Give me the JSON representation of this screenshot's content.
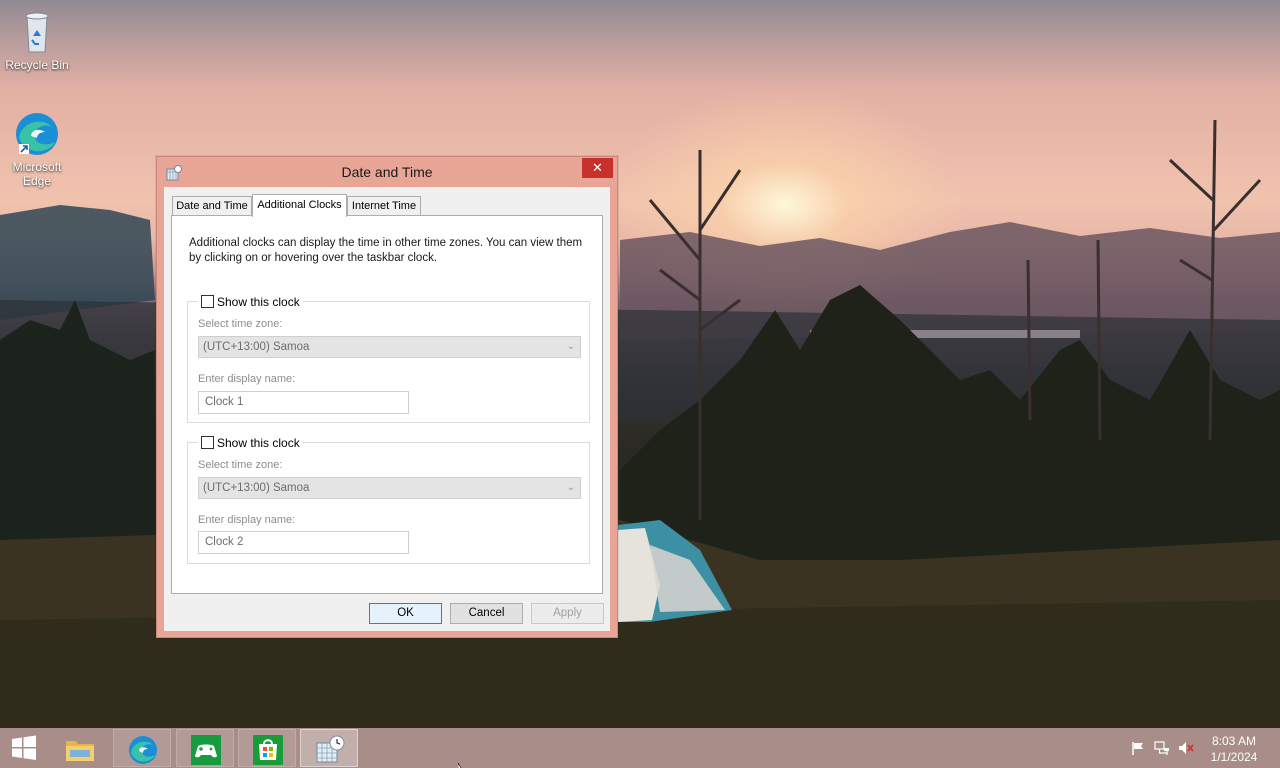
{
  "desktop": {
    "icons": [
      {
        "label": "Recycle Bin",
        "icon": "recycle-bin-icon"
      },
      {
        "label": "Microsoft Edge",
        "icon": "edge-icon"
      }
    ]
  },
  "dialog": {
    "title": "Date and Time",
    "close_label": "✕",
    "tabs": [
      {
        "label": "Date and Time",
        "active": false
      },
      {
        "label": "Additional Clocks",
        "active": true
      },
      {
        "label": "Internet Time",
        "active": false
      }
    ],
    "intro": "Additional clocks can display the time in other time zones. You can view them by clicking on or hovering over the taskbar clock.",
    "clocks": [
      {
        "show_label": "Show this clock",
        "checked": false,
        "timezone_label": "Select time zone:",
        "timezone_value": "(UTC+13:00) Samoa",
        "name_label": "Enter display name:",
        "name_value": "Clock 1"
      },
      {
        "show_label": "Show this clock",
        "checked": false,
        "timezone_label": "Select time zone:",
        "timezone_value": "(UTC+13:00) Samoa",
        "name_label": "Enter display name:",
        "name_value": "Clock 2"
      }
    ],
    "buttons": {
      "ok": "OK",
      "cancel": "Cancel",
      "apply": "Apply"
    }
  },
  "taskbar": {
    "apps": [
      {
        "name": "start-button",
        "icon": "windows-logo-icon"
      },
      {
        "name": "file-explorer",
        "icon": "folder-icon"
      },
      {
        "name": "microsoft-edge",
        "icon": "edge-icon"
      },
      {
        "name": "xbox",
        "icon": "gamepad-icon"
      },
      {
        "name": "microsoft-store",
        "icon": "store-icon"
      },
      {
        "name": "date-and-time",
        "icon": "calendar-clock-icon"
      }
    ],
    "tray": {
      "icons": [
        "flag-icon",
        "network-icon",
        "volume-muted-icon"
      ],
      "time": "8:03 AM",
      "date": "1/1/2024"
    }
  },
  "colors": {
    "taskbar": "#a88d88",
    "dialog_frame": "#e8a596",
    "close_button": "#c7302b",
    "default_button_border": "#3c7fb1"
  }
}
